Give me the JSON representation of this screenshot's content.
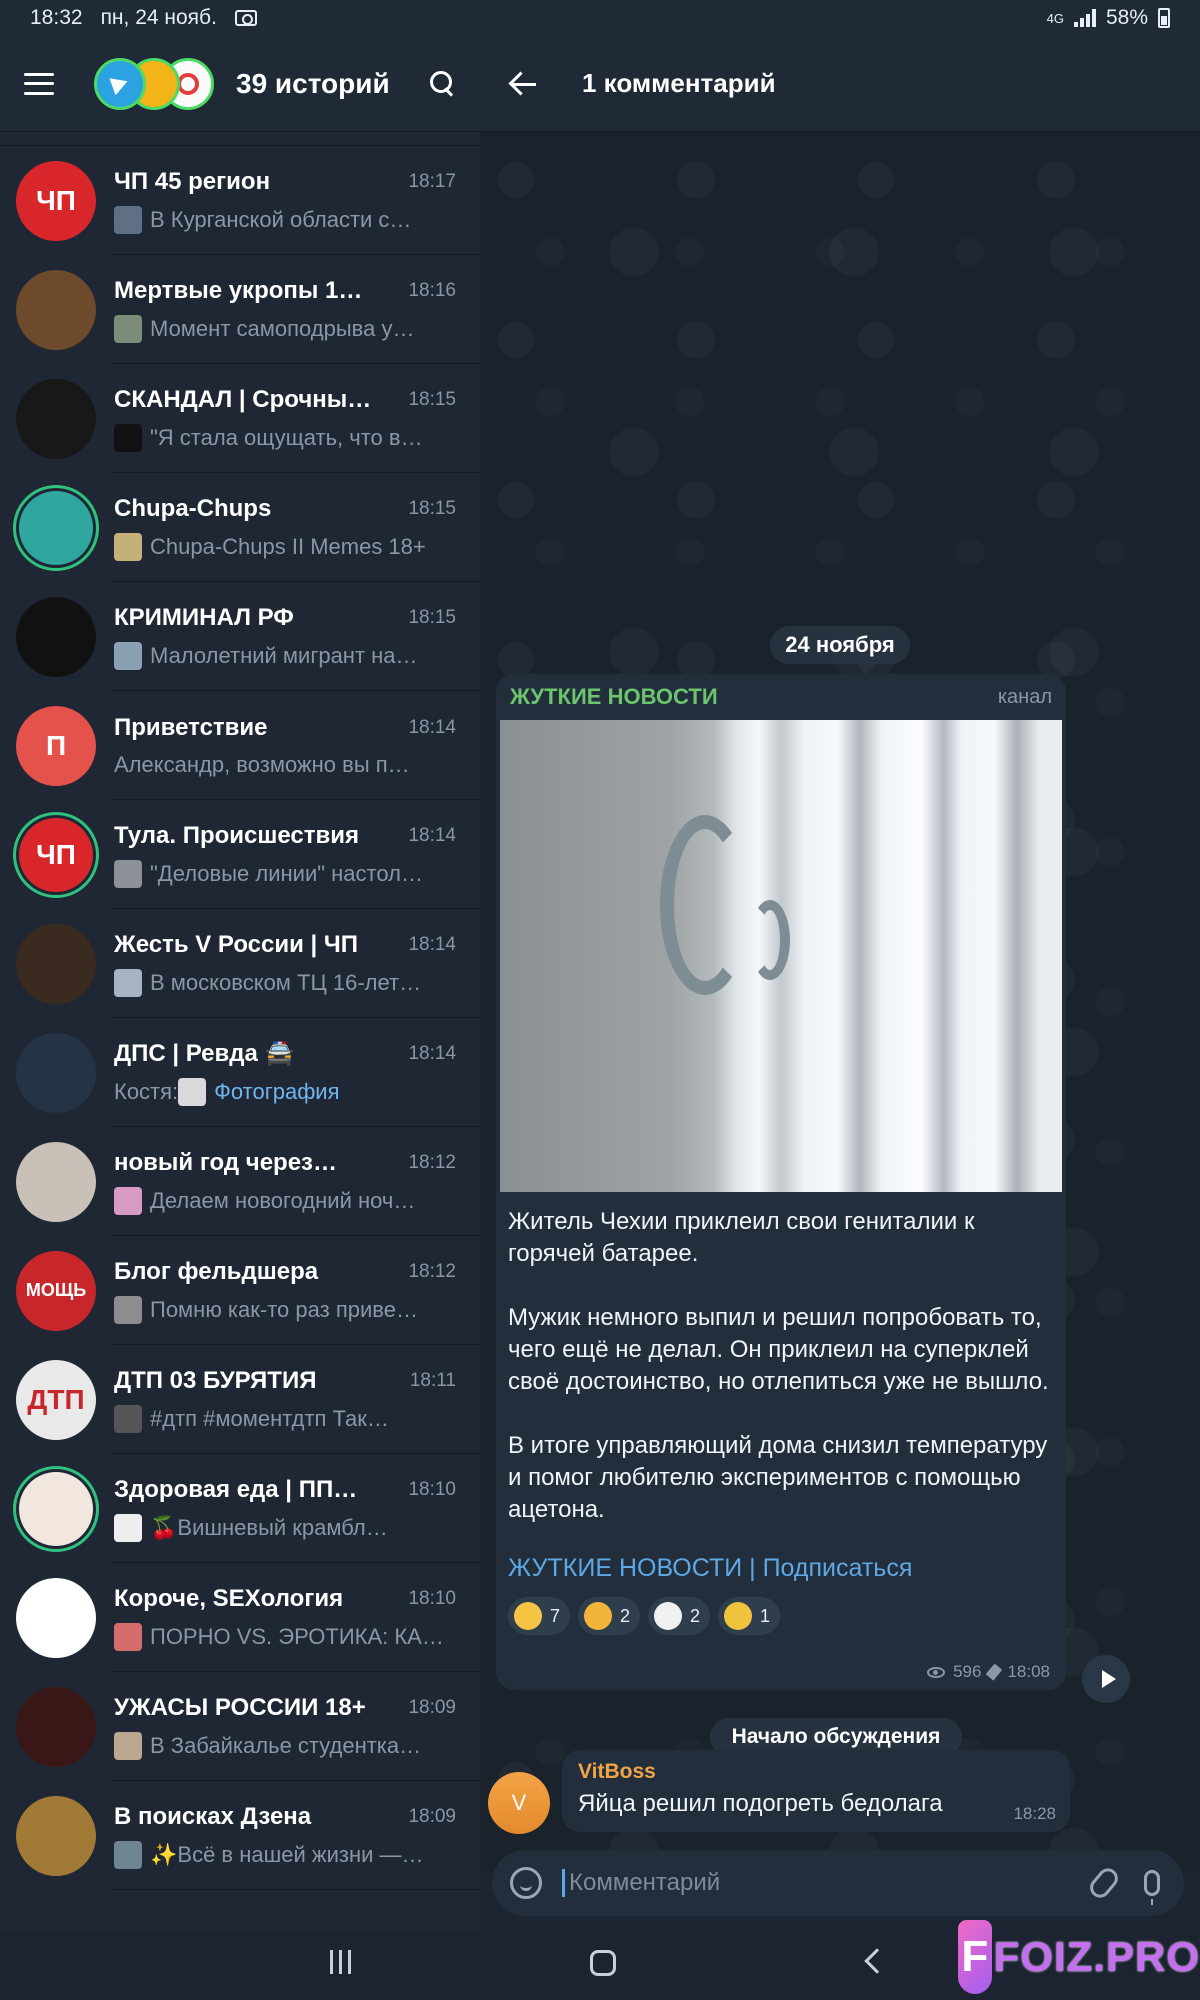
{
  "status_bar": {
    "time": "18:32",
    "date": "пн, 24 нояб.",
    "network": "4G",
    "battery": "58%"
  },
  "left_header": {
    "title": "39 историй"
  },
  "chats": [
    {
      "name": "ЧП 45 регион",
      "time": "18:17",
      "preview": "В Курганской области с…",
      "avatar_text": "ЧП",
      "avatar_color": "#d8262b",
      "thumb_color": "#5d7086"
    },
    {
      "name": "Мертвые укропы 1…",
      "time": "18:16",
      "preview": "Момент самоподрыва у…",
      "avatar_text": "",
      "avatar_color": "#6d4a2b",
      "thumb_color": "#7d8c7a"
    },
    {
      "name": "СКАНДАЛ | Срочны…",
      "time": "18:15",
      "preview": "\"Я стала ощущать, что в…",
      "avatar_text": "",
      "avatar_color": "#181818",
      "thumb_color": "#111111"
    },
    {
      "name": "Chupa-Chups",
      "time": "18:15",
      "preview": "Chupa-Chups II Memes 18+",
      "avatar_text": "",
      "avatar_color": "#2fa79f",
      "thumb_color": "#c5b077",
      "ring": true
    },
    {
      "name": "КРИМИНАЛ РФ",
      "time": "18:15",
      "preview": "Малолетний мигрант на…",
      "avatar_text": "",
      "avatar_color": "#111111",
      "thumb_color": "#8ca0b3"
    },
    {
      "name": "Приветствие",
      "time": "18:14",
      "preview": "Александр, возможно вы п…",
      "avatar_text": "П",
      "avatar_color": "#e5524c",
      "thumb_color": ""
    },
    {
      "name": "Тула. Происшествия",
      "time": "18:14",
      "preview": "\"Деловые линии\" настол…",
      "avatar_text": "ЧП",
      "avatar_color": "#d8262b",
      "thumb_color": "#8b9196",
      "ring": true
    },
    {
      "name": "Жесть V России | ЧП",
      "time": "18:14",
      "preview": "В московском ТЦ 16-лет…",
      "avatar_text": "",
      "avatar_color": "#3a2a1f",
      "thumb_color": "#a7b3c1"
    },
    {
      "name": "ДПС | Ревда 🚔",
      "time": "18:14",
      "preview_sender": "Костя: ",
      "preview_link": "Фотография",
      "avatar_text": "",
      "avatar_color": "#243446",
      "thumb_color": "#d9d9d9"
    },
    {
      "name": "новый год через…",
      "time": "18:12",
      "preview": "Делаем новогодний ноч…",
      "avatar_text": "",
      "avatar_color": "#c9c0b8",
      "thumb_color": "#d69ac3"
    },
    {
      "name": "Блог фельдшера",
      "time": "18:12",
      "preview": "Помню как-то раз приве…",
      "avatar_text": "МОЩЬ",
      "avatar_color": "#c8262b",
      "thumb_color": "#8d8d8d"
    },
    {
      "name": "ДТП 03 БУРЯТИЯ",
      "time": "18:11",
      "preview": "#дтп  #моментдтп   Так…",
      "avatar_text": "ДТП",
      "avatar_color": "#e9e9e9",
      "thumb_color": "#555555"
    },
    {
      "name": "Здоровая еда | ПП…",
      "time": "18:10",
      "preview": "🍒Вишневый крамбл…",
      "avatar_text": "",
      "avatar_color": "#f1e7df",
      "thumb_color": "#eeeeee",
      "ring": true
    },
    {
      "name": "Короче, SEXология",
      "time": "18:10",
      "preview": "ПОРНО VS. ЭРОТИКА: КА…",
      "avatar_text": "",
      "avatar_color": "#ffffff",
      "thumb_color": "#d56b6b"
    },
    {
      "name": "УЖАСЫ РОССИИ 18+",
      "time": "18:09",
      "preview": "В Забайкалье студентка…",
      "avatar_text": "",
      "avatar_color": "#3a1717",
      "thumb_color": "#b9a88f"
    },
    {
      "name": "В поисках Дзена",
      "time": "18:09",
      "preview": "✨Всё в нашей жизни —…",
      "avatar_text": "",
      "avatar_color": "#a07a36",
      "thumb_color": "#6e8591"
    }
  ],
  "right_header": {
    "title": "1 комментарий"
  },
  "date_separator": "24 ноября",
  "post": {
    "channel": "ЖУТКИЕ НОВОСТИ",
    "type": "канал",
    "paragraphs": [
      "Житель Чехии приклеил свои гениталии к горячей батарее.",
      "Мужик немного выпил и решил попробовать то, чего ещё не делал. Он приклеил на суперклей своё достоинство, но отлепиться уже не вышло.",
      "В итоге управляющий дома снизил температуру и помог любителю экспериментов с помощью ацетона."
    ],
    "link": "ЖУТКИЕ НОВОСТИ | Подписаться",
    "reactions": [
      {
        "emoji": "grin",
        "count": "7",
        "color": "#f6c443"
      },
      {
        "emoji": "thumbs-up",
        "count": "2",
        "color": "#f2b43a"
      },
      {
        "emoji": "clown",
        "count": "2",
        "color": "#f0f0f0"
      },
      {
        "emoji": "pill",
        "count": "1",
        "color": "#f0c33c"
      }
    ],
    "views": "596",
    "time": "18:08"
  },
  "discussion_label": "Начало обсуждения",
  "comment": {
    "avatar_letter": "V",
    "author": "VitBoss",
    "text": "Яйца решил подогреть бедолага",
    "time": "18:28"
  },
  "input": {
    "placeholder": "Комментарий"
  },
  "watermark": "FOIZ.PRO"
}
